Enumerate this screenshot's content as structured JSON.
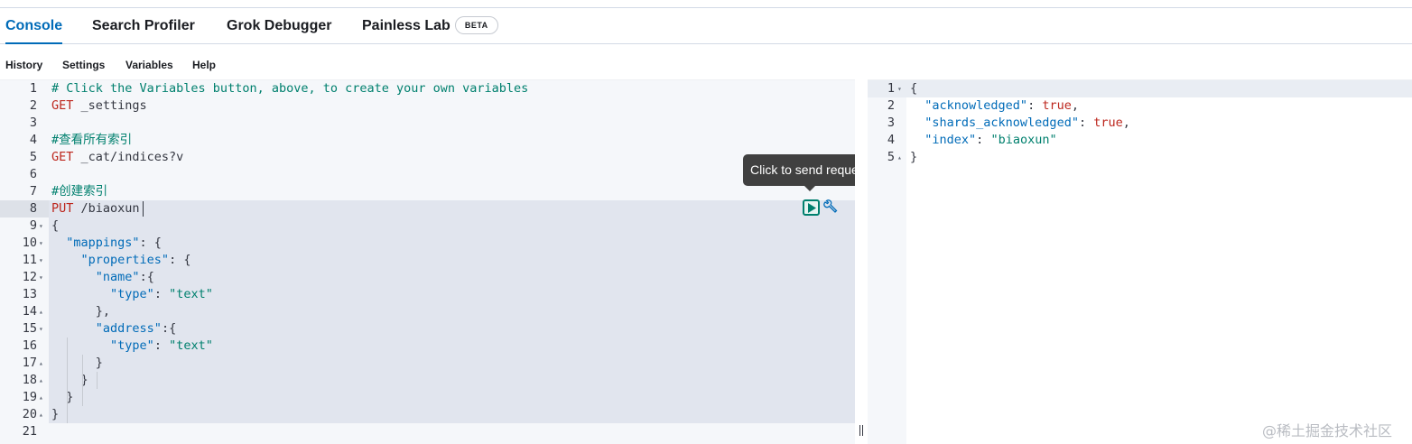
{
  "tabs": [
    {
      "label": "Console",
      "active": true
    },
    {
      "label": "Search Profiler",
      "active": false
    },
    {
      "label": "Grok Debugger",
      "active": false
    },
    {
      "label": "Painless Lab",
      "active": false,
      "badge": "BETA"
    }
  ],
  "menu": [
    "History",
    "Settings",
    "Variables",
    "Help"
  ],
  "editor": {
    "lines": [
      {
        "n": "1",
        "fold": "",
        "text": "# Click the Variables button, above, to create your own variables"
      },
      {
        "n": "2",
        "fold": "",
        "text": "GET _settings"
      },
      {
        "n": "3",
        "fold": "",
        "text": ""
      },
      {
        "n": "4",
        "fold": "",
        "text": "#查看所有索引"
      },
      {
        "n": "5",
        "fold": "",
        "text": "GET _cat/indices?v"
      },
      {
        "n": "6",
        "fold": "",
        "text": ""
      },
      {
        "n": "7",
        "fold": "",
        "text": "#创建索引"
      },
      {
        "n": "8",
        "fold": "",
        "text": "PUT /biaoxun"
      },
      {
        "n": "9",
        "fold": "▾",
        "text": "{"
      },
      {
        "n": "10",
        "fold": "▾",
        "text": "  \"mappings\": {"
      },
      {
        "n": "11",
        "fold": "▾",
        "text": "    \"properties\": {"
      },
      {
        "n": "12",
        "fold": "▾",
        "text": "      \"name\":{"
      },
      {
        "n": "13",
        "fold": "",
        "text": "        \"type\": \"text\""
      },
      {
        "n": "14",
        "fold": "▴",
        "text": "      },"
      },
      {
        "n": "15",
        "fold": "▾",
        "text": "      \"address\":{"
      },
      {
        "n": "16",
        "fold": "",
        "text": "        \"type\": \"text\""
      },
      {
        "n": "17",
        "fold": "▴",
        "text": "      }"
      },
      {
        "n": "18",
        "fold": "▴",
        "text": "    }"
      },
      {
        "n": "19",
        "fold": "▴",
        "text": "  }"
      },
      {
        "n": "20",
        "fold": "▴",
        "text": "}"
      },
      {
        "n": "21",
        "fold": "",
        "text": ""
      }
    ],
    "tooltip": "Click to send request",
    "send_icon": "play-icon",
    "wrench_icon": "wrench-icon"
  },
  "output": {
    "lines": [
      {
        "n": "1",
        "fold": "▾",
        "text": "{"
      },
      {
        "n": "2",
        "fold": "",
        "text": "  \"acknowledged\": true,"
      },
      {
        "n": "3",
        "fold": "",
        "text": "  \"shards_acknowledged\": true,"
      },
      {
        "n": "4",
        "fold": "",
        "text": "  \"index\": \"biaoxun\""
      },
      {
        "n": "5",
        "fold": "▴",
        "text": "}"
      }
    ]
  },
  "watermark": "@稀土掘金技术社区",
  "colors": {
    "accent": "#006bb8",
    "comment": "#00806e",
    "method": "#bd271e",
    "string": "#00806e"
  }
}
